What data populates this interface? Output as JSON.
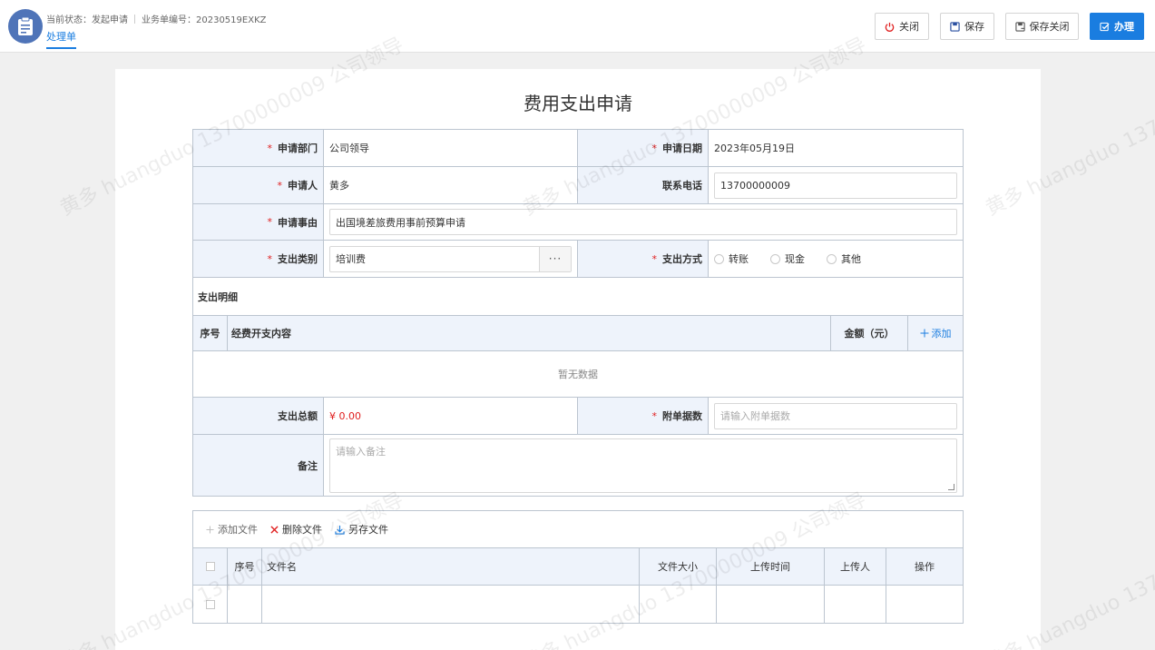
{
  "header": {
    "status_label": "当前状态：发起申请",
    "doc_no_label": "业务单编号：20230519EXKZ",
    "tab": "处理单",
    "buttons": {
      "close": "关闭",
      "save": "保存",
      "save_close": "保存关闭",
      "handle": "办理"
    }
  },
  "form": {
    "title": "费用支出申请",
    "dept_label": "申请部门",
    "dept_value": "公司领导",
    "date_label": "申请日期",
    "date_value": "2023年05月19日",
    "applicant_label": "申请人",
    "applicant_value": "黄多",
    "phone_label": "联系电话",
    "phone_value": "13700000009",
    "reason_label": "申请事由",
    "reason_value": "出国境差旅费用事前预算申请",
    "category_label": "支出类别",
    "category_value": "培训费",
    "category_more": "···",
    "method_label": "支出方式",
    "method_options": [
      "转账",
      "现金",
      "其他"
    ],
    "detail_section": "支出明细",
    "detail_columns": {
      "no": "序号",
      "content": "经费开支内容",
      "amount": "金额（元）",
      "add": "添加"
    },
    "detail_empty": "暂无数据",
    "total_label": "支出总额",
    "total_value": "¥ 0.00",
    "attach_label": "附单据数",
    "attach_placeholder": "请输入附单据数",
    "remark_label": "备注",
    "remark_placeholder": "请输入备注",
    "required_mark": "*"
  },
  "files": {
    "toolbar": {
      "add": "添加文件",
      "delete": "删除文件",
      "save_as": "另存文件"
    },
    "columns": {
      "no": "序号",
      "name": "文件名",
      "size": "文件大小",
      "time": "上传时间",
      "uploader": "上传人",
      "action": "操作"
    }
  },
  "watermark": "黄多 huangduo 13700000009 公司领导",
  "colors": {
    "primary": "#1a7de0",
    "label_bg": "#eef3fb",
    "required": "#e02020"
  }
}
